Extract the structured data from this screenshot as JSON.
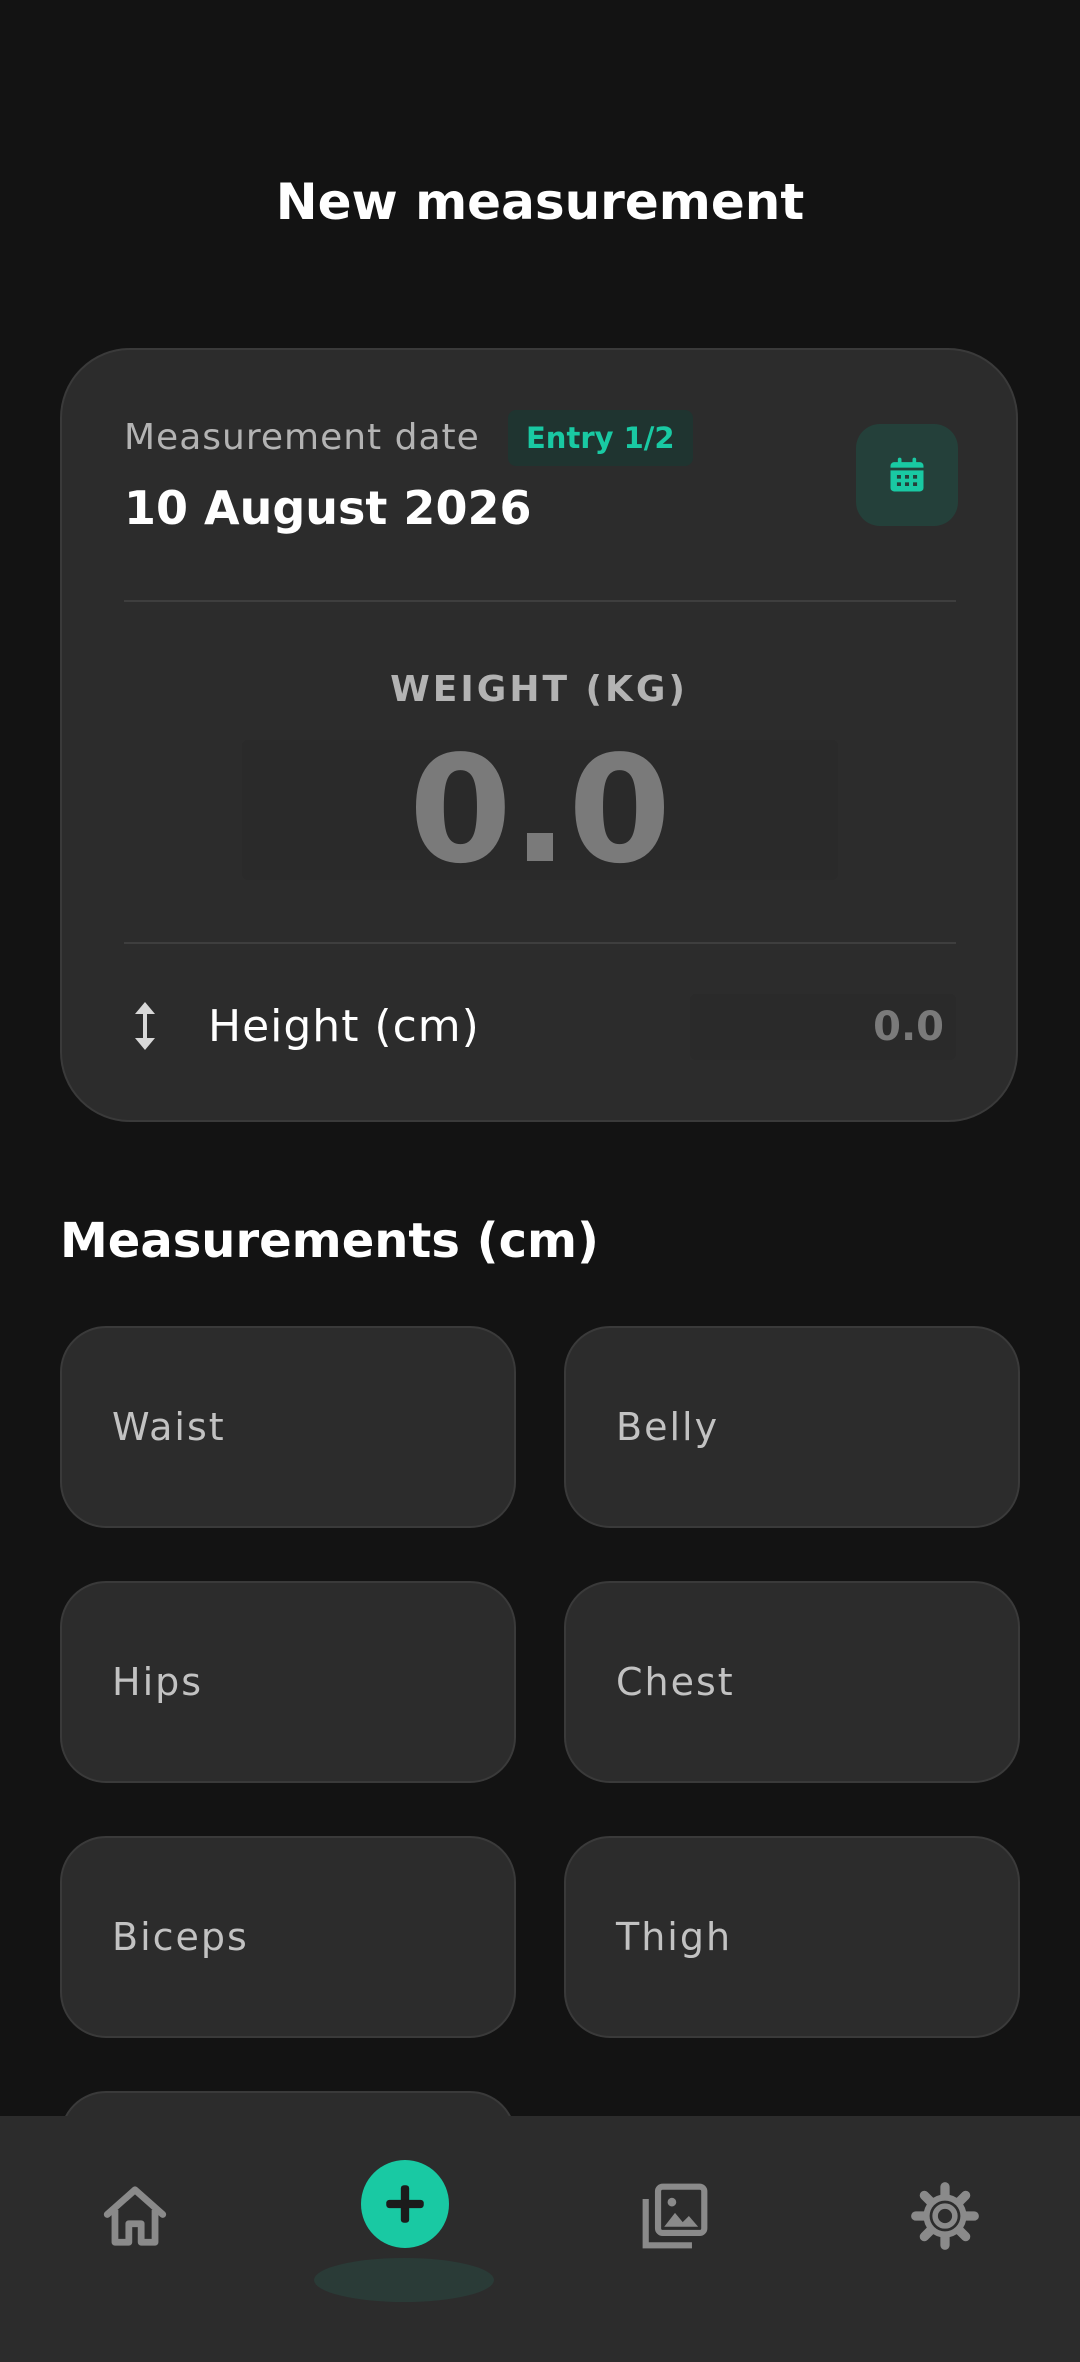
{
  "page": {
    "title": "New measurement"
  },
  "date_card": {
    "label": "Measurement date",
    "entry_badge": "Entry 1/2",
    "date_value": "10 August 2026",
    "calendar_icon": "calendar-icon"
  },
  "weight": {
    "label": "WEIGHT (KG)",
    "value": "0.0"
  },
  "height": {
    "icon": "vertical-arrows-icon",
    "label": "Height (cm)",
    "value": "0.0"
  },
  "measurements": {
    "title": "Measurements (cm)",
    "fields": [
      {
        "label": "Waist"
      },
      {
        "label": "Belly"
      },
      {
        "label": "Hips"
      },
      {
        "label": "Chest"
      },
      {
        "label": "Biceps"
      },
      {
        "label": "Thigh"
      }
    ]
  },
  "bottom_nav": {
    "items": [
      {
        "name": "home",
        "icon": "home-icon"
      },
      {
        "name": "add",
        "icon": "plus-icon",
        "active": true
      },
      {
        "name": "gallery",
        "icon": "gallery-icon"
      },
      {
        "name": "settings",
        "icon": "gear-icon"
      }
    ]
  },
  "colors": {
    "background": "#131313",
    "card": "#2c2c2c",
    "accent": "#19c9a3",
    "muted_text": "#b3b3b3",
    "placeholder": "#7a7a7a"
  }
}
